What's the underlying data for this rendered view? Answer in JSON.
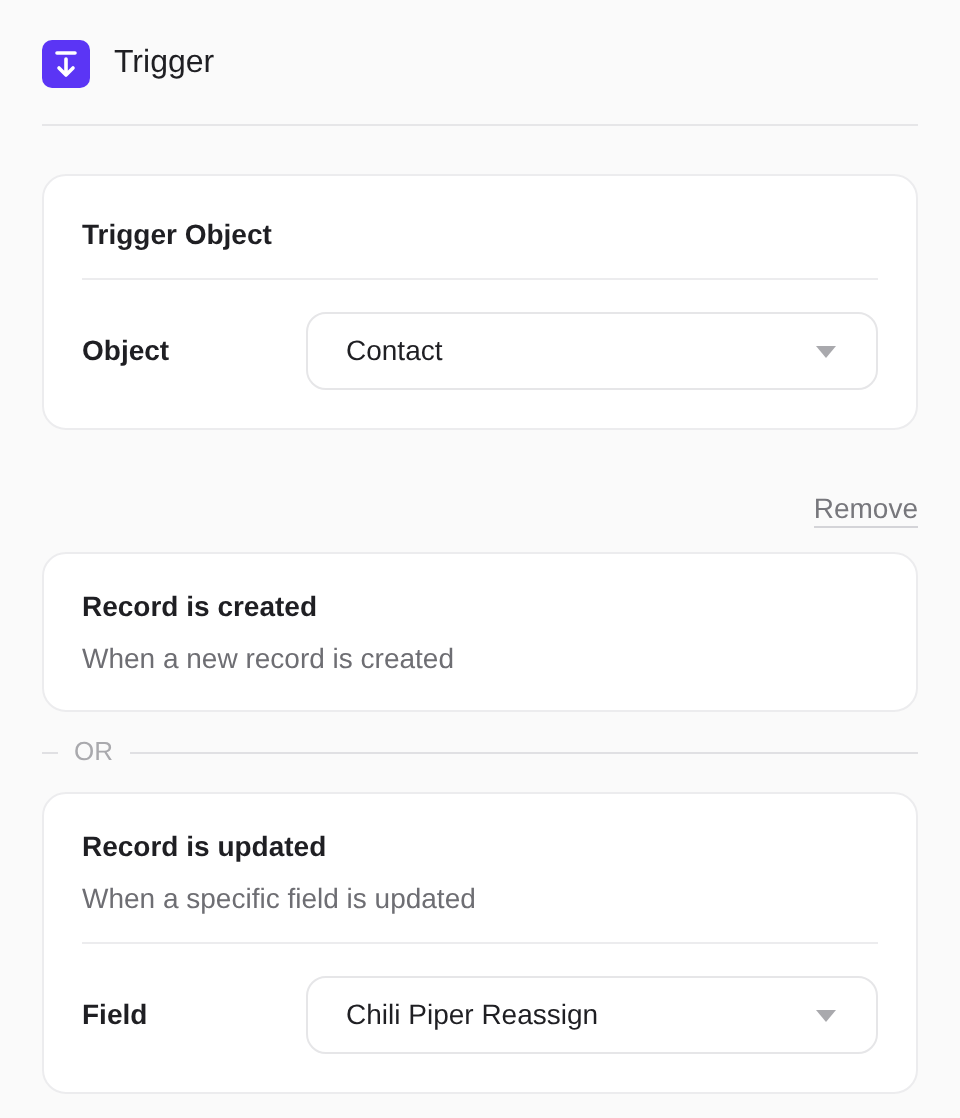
{
  "header": {
    "title": "Trigger"
  },
  "object_card": {
    "title": "Trigger Object",
    "field": {
      "label": "Object",
      "value": "Contact"
    }
  },
  "remove_link": "Remove",
  "conditions": [
    {
      "title": "Record is created",
      "description": "When a new record is created"
    },
    {
      "title": "Record is updated",
      "description": "When a specific field is updated",
      "field": {
        "label": "Field",
        "value": "Chili Piper Reassign"
      }
    }
  ],
  "separator": "OR"
}
